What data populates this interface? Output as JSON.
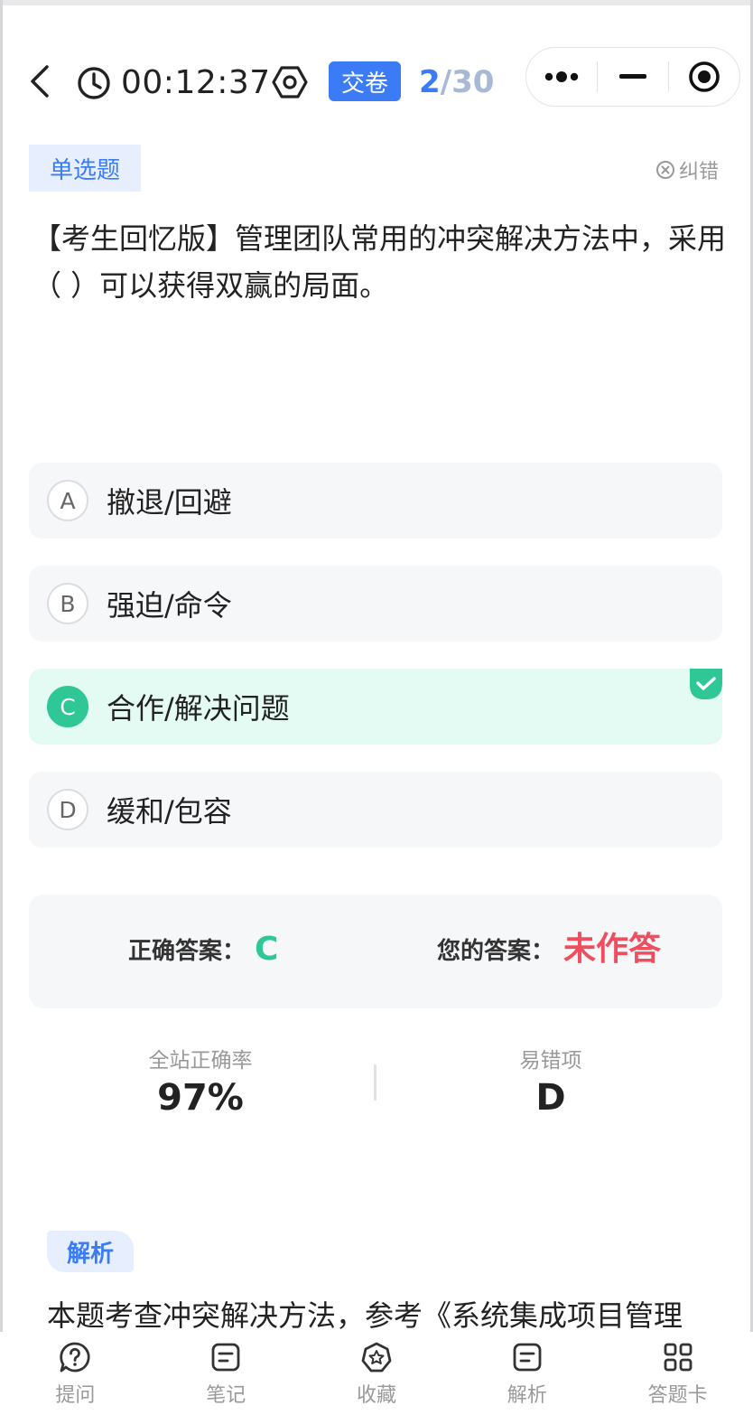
{
  "header": {
    "timer": "00:12:37",
    "submit_label": "交卷",
    "progress_current": "2",
    "progress_total": "/30"
  },
  "capsule": {
    "icons": [
      "more-icon",
      "minimize-icon",
      "close-target-icon"
    ]
  },
  "question": {
    "type_label": "单选题",
    "report_label": "纠错",
    "text": "【考生回忆版】管理团队常用的冲突解决方法中，采用（  ）可以获得双赢的局面。",
    "options": [
      {
        "letter": "A",
        "text": "撤退/回避",
        "state": "normal"
      },
      {
        "letter": "B",
        "text": "强迫/命令",
        "state": "normal"
      },
      {
        "letter": "C",
        "text": "合作/解决问题",
        "state": "correct"
      },
      {
        "letter": "D",
        "text": "缓和/包容",
        "state": "normal"
      }
    ]
  },
  "result": {
    "correct_label": "正确答案：",
    "correct_value": "C",
    "yours_label": "您的答案：",
    "yours_value": "未作答"
  },
  "stats": {
    "accuracy_label": "全站正确率",
    "accuracy_value": "97%",
    "common_wrong_label": "易错项",
    "common_wrong_value": "D"
  },
  "analysis": {
    "tag": "解析",
    "text": "本题考查冲突解决方法，参考《系统集成项目管理"
  },
  "bottombar": {
    "tabs": [
      {
        "label": "提问",
        "icon": "question-bubble-icon"
      },
      {
        "label": "笔记",
        "icon": "note-icon"
      },
      {
        "label": "收藏",
        "icon": "favorite-icon"
      },
      {
        "label": "解析",
        "icon": "analysis-icon"
      },
      {
        "label": "答题卡",
        "icon": "answer-card-icon"
      }
    ]
  },
  "colors": {
    "accent": "#3b7cf6",
    "correct": "#2fc795",
    "wrong": "#f04e5e"
  }
}
